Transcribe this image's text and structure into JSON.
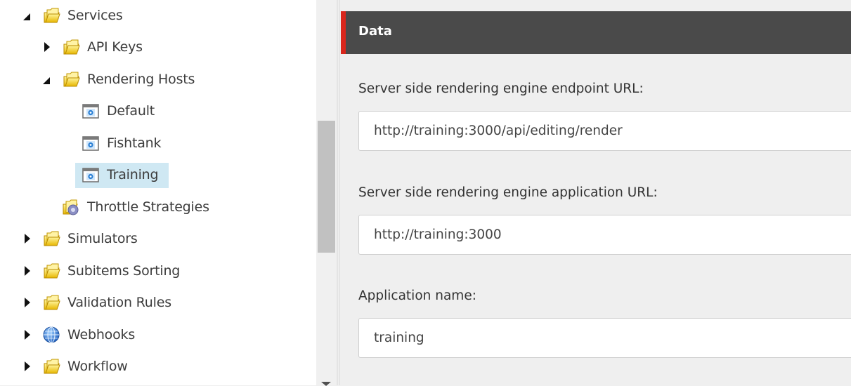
{
  "tree": {
    "items": [
      {
        "label": "Services",
        "level": 0,
        "state": "expanded",
        "icon": "folder-icon"
      },
      {
        "label": "API Keys",
        "level": 1,
        "state": "collapsed",
        "icon": "folder-icon"
      },
      {
        "label": "Rendering Hosts",
        "level": 1,
        "state": "expanded",
        "icon": "folder-icon"
      },
      {
        "label": "Default",
        "level": 2,
        "state": "leaf",
        "icon": "rendering-host-icon"
      },
      {
        "label": "Fishtank",
        "level": 2,
        "state": "leaf",
        "icon": "rendering-host-icon"
      },
      {
        "label": "Training",
        "level": 2,
        "state": "leaf",
        "icon": "rendering-host-icon",
        "selected": true
      },
      {
        "label": "Throttle Strategies",
        "level": 1,
        "state": "leaf",
        "icon": "folder-gear-icon"
      },
      {
        "label": "Simulators",
        "level": 0,
        "state": "collapsed",
        "icon": "folder-icon"
      },
      {
        "label": "Subitems Sorting",
        "level": 0,
        "state": "collapsed",
        "icon": "folder-icon"
      },
      {
        "label": "Validation Rules",
        "level": 0,
        "state": "collapsed",
        "icon": "folder-icon"
      },
      {
        "label": "Webhooks",
        "level": 0,
        "state": "collapsed",
        "icon": "globe-icon"
      },
      {
        "label": "Workflow",
        "level": 0,
        "state": "collapsed",
        "icon": "folder-icon"
      }
    ]
  },
  "section": {
    "title": "Data",
    "accent_color": "#d9261c"
  },
  "fields": [
    {
      "label": "Server side rendering engine endpoint URL:",
      "value": "http://training:3000/api/editing/render"
    },
    {
      "label": "Server side rendering engine application URL:",
      "value": "http://training:3000"
    },
    {
      "label": "Application name:",
      "value": "training"
    }
  ],
  "colors": {
    "selected_bg": "#cfe8f3",
    "header_bg": "#4a4a4a"
  }
}
